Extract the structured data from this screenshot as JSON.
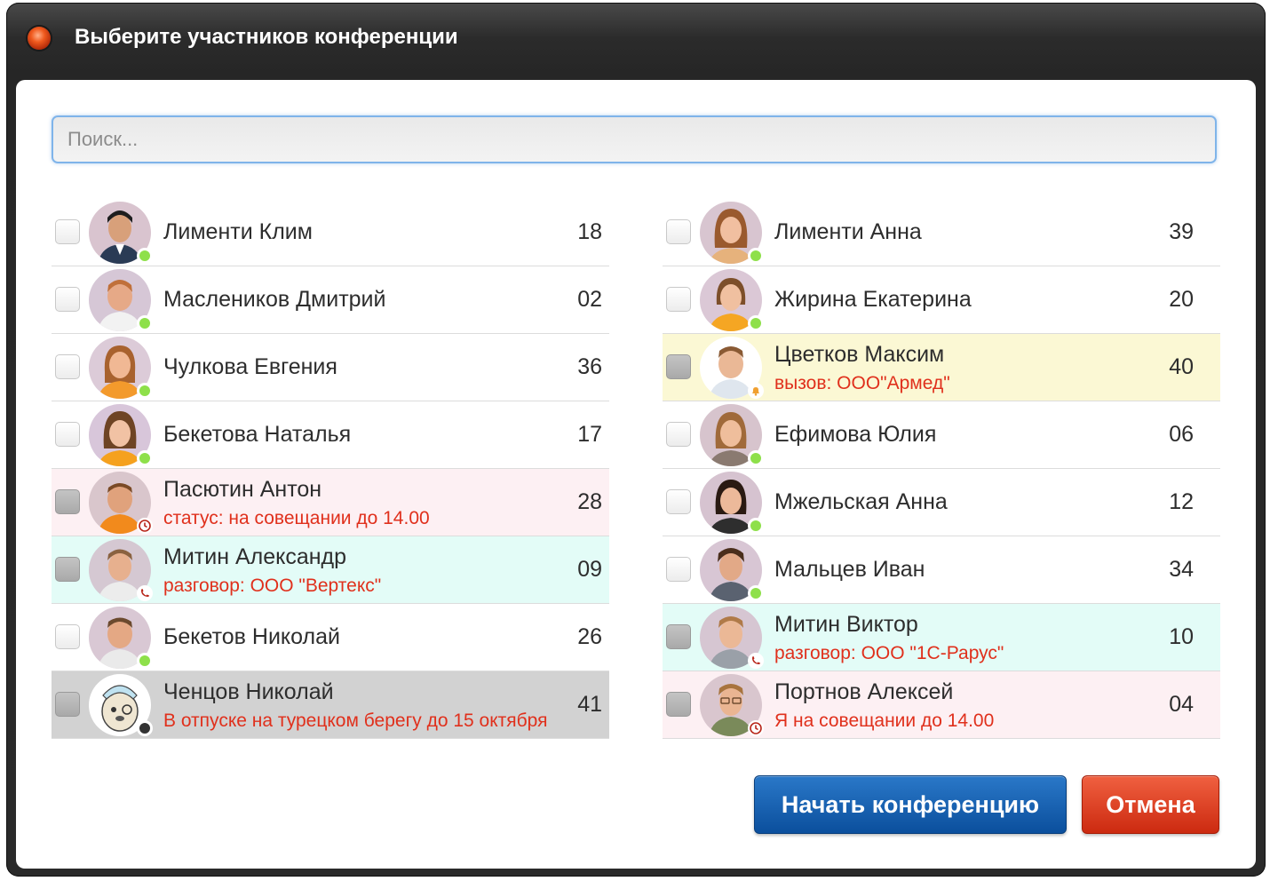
{
  "window": {
    "title": "Выберите участников конференции"
  },
  "search": {
    "placeholder": "Поиск..."
  },
  "colors": {
    "online": "#8ee04a",
    "busy_text": "#e0301c",
    "row_pink": "#fdf0f3",
    "row_mint": "#e3fcf7",
    "row_yellow": "#fbf8d4",
    "row_gray": "#d2d2d2",
    "start_button": "#0b4f9d",
    "cancel_button": "#cc2a10"
  },
  "left_column": [
    {
      "name": "Лименти Клим",
      "ext": "18",
      "status": "online"
    },
    {
      "name": "Маслеников Дмитрий",
      "ext": "02",
      "status": "online"
    },
    {
      "name": "Чулкова Евгения",
      "ext": "36",
      "status": "online"
    },
    {
      "name": "Бекетова Наталья",
      "ext": "17",
      "status": "online"
    },
    {
      "name": "Пасютин Антон",
      "ext": "28",
      "status": "clock-icon",
      "note": "статус: на совещании до 14.00"
    },
    {
      "name": "Митин Александр",
      "ext": "09",
      "status": "phone-icon",
      "note": "разговор: ООО \"Вертекс\""
    },
    {
      "name": "Бекетов Николай",
      "ext": "26",
      "status": "online"
    },
    {
      "name": "Ченцов Николай",
      "ext": "41",
      "status": "offline",
      "note": "В отпуске на турецком берегу до 15 октября"
    }
  ],
  "right_column": [
    {
      "name": "Лименти Анна",
      "ext": "39",
      "status": "online"
    },
    {
      "name": "Жирина Екатерина",
      "ext": "20",
      "status": "online"
    },
    {
      "name": "Цветков Максим",
      "ext": "40",
      "status": "bell-icon",
      "note": "вызов: ООО\"Армед\""
    },
    {
      "name": "Ефимова Юлия",
      "ext": "06",
      "status": "online"
    },
    {
      "name": "Мжельская Анна",
      "ext": "12",
      "status": "online"
    },
    {
      "name": "Мальцев Иван",
      "ext": "34",
      "status": "online"
    },
    {
      "name": "Митин Виктор",
      "ext": "10",
      "status": "phone-icon",
      "note": "разговор: ООО \"1С-Рарус\""
    },
    {
      "name": "Портнов Алексей",
      "ext": "04",
      "status": "clock-icon",
      "note": "Я на совещании до 14.00"
    }
  ],
  "buttons": {
    "start": "Начать конференцию",
    "cancel": "Отмена"
  }
}
